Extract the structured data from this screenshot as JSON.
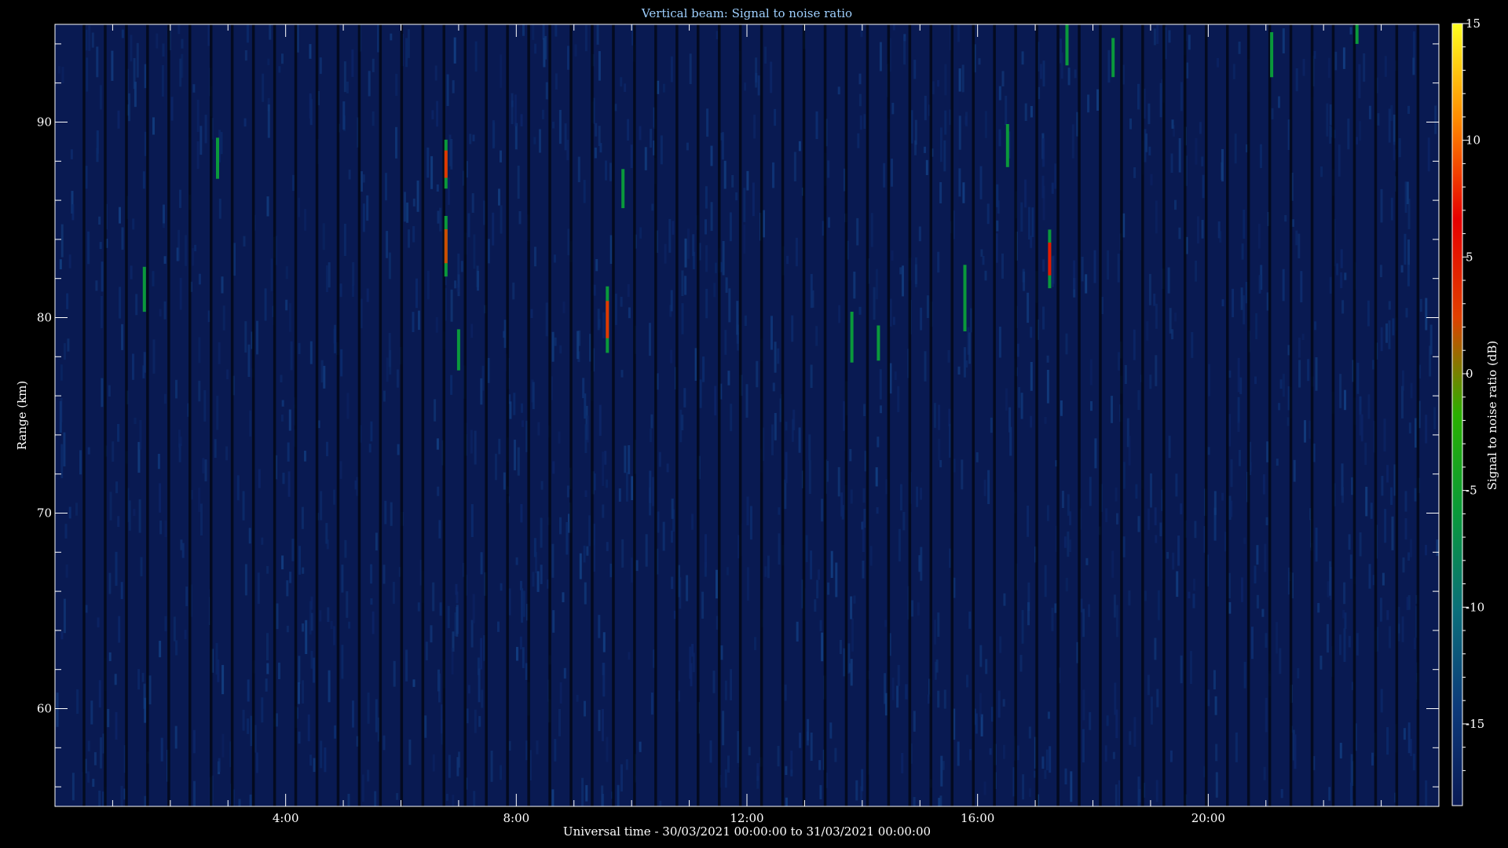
{
  "chart_data": {
    "type": "heatmap",
    "title": "Vertical beam: Signal to noise ratio",
    "xlabel": "Universal time - 30/03/2021 00:00:00 to 31/03/2021 00:00:00",
    "ylabel": "Range (km)",
    "colorbar_label": "Signal to noise ratio (dB)",
    "x_unit": "hours UT",
    "xlim": [
      0,
      24
    ],
    "ylim": [
      55,
      95
    ],
    "clim": [
      -18.5,
      15
    ],
    "x_ticks": [
      {
        "value": 4,
        "label": "4:00"
      },
      {
        "value": 8,
        "label": "8:00"
      },
      {
        "value": 12,
        "label": "12:00"
      },
      {
        "value": 16,
        "label": "16:00"
      },
      {
        "value": 20,
        "label": "20:00"
      }
    ],
    "y_ticks": [
      {
        "value": 60,
        "label": "60"
      },
      {
        "value": 70,
        "label": "70"
      },
      {
        "value": 80,
        "label": "80"
      },
      {
        "value": 90,
        "label": "90"
      }
    ],
    "colorbar_ticks": [
      {
        "value": 15,
        "label": "15"
      },
      {
        "value": 10,
        "label": "10"
      },
      {
        "value": 5,
        "label": "5"
      },
      {
        "value": 0,
        "label": "0"
      },
      {
        "value": -5,
        "label": "-5"
      },
      {
        "value": -10,
        "label": "-10"
      },
      {
        "value": -15,
        "label": "-15"
      }
    ],
    "colormap": [
      "#0a1a55",
      "#0d3a7a",
      "#0b6f7a",
      "#0a9a3a",
      "#2ab000",
      "#e04000",
      "#e60000",
      "#ff8800",
      "#ffff20"
    ],
    "background_snr_db": -16,
    "events": [
      {
        "time": 1.55,
        "range_min": 80.3,
        "range_max": 82.6,
        "snr": -4
      },
      {
        "time": 2.82,
        "range_min": 87.1,
        "range_max": 89.2,
        "snr": -4
      },
      {
        "time": 6.78,
        "range_min": 86.6,
        "range_max": 89.1,
        "snr": 3
      },
      {
        "time": 6.78,
        "range_min": 82.1,
        "range_max": 85.2,
        "snr": 2
      },
      {
        "time": 7.0,
        "range_min": 77.3,
        "range_max": 79.4,
        "snr": -6
      },
      {
        "time": 9.58,
        "range_min": 78.2,
        "range_max": 81.6,
        "snr": 3
      },
      {
        "time": 9.85,
        "range_min": 85.6,
        "range_max": 87.6,
        "snr": -4
      },
      {
        "time": 13.82,
        "range_min": 77.7,
        "range_max": 80.3,
        "snr": -4
      },
      {
        "time": 14.28,
        "range_min": 77.8,
        "range_max": 79.6,
        "snr": -5
      },
      {
        "time": 15.78,
        "range_min": 79.3,
        "range_max": 82.7,
        "snr": -4
      },
      {
        "time": 16.52,
        "range_min": 87.7,
        "range_max": 89.9,
        "snr": -5
      },
      {
        "time": 17.25,
        "range_min": 81.5,
        "range_max": 84.5,
        "snr": 5
      },
      {
        "time": 17.55,
        "range_min": 92.9,
        "range_max": 95.0,
        "snr": -4
      },
      {
        "time": 18.35,
        "range_min": 92.3,
        "range_max": 94.3,
        "snr": -5
      },
      {
        "time": 21.1,
        "range_min": 92.3,
        "range_max": 94.6,
        "snr": -4
      },
      {
        "time": 22.58,
        "range_min": 94.0,
        "range_max": 95.0,
        "snr": -5
      }
    ],
    "grid": false,
    "legend": "colorbar-right"
  }
}
